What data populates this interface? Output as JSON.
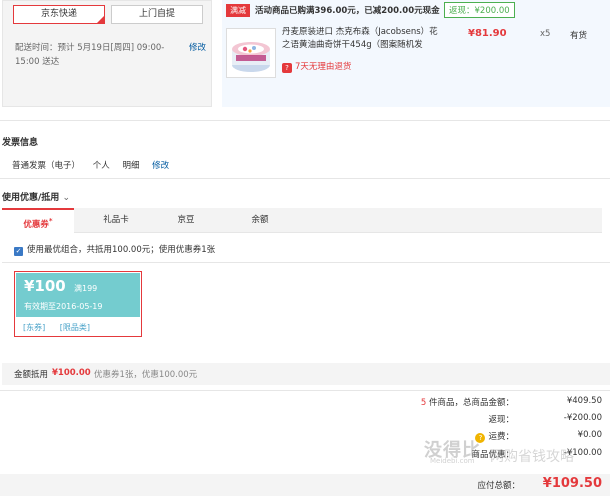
{
  "shipping": {
    "options": [
      "京东快递",
      "上门自提"
    ],
    "time_label": "配送时间：",
    "time_value": "预计 5月19日[周四] 09:00-15:00 送达",
    "edit": "修改"
  },
  "goods": {
    "promo_tag": "满减",
    "promo_text": "活动商品已购满396.00元，已减200.00元现金",
    "rebate": "返现：¥200.00",
    "name": "丹麦原装进口 杰克布森（Jacobsens）花之语黄油曲奇饼干454g（图案随机发",
    "price": "¥81.90",
    "qty": "x5",
    "stock": "有货",
    "return_policy": "7天无理由退货"
  },
  "invoice": {
    "title": "发票信息",
    "type": "普通发票（电子）",
    "holder": "个人",
    "content": "明细",
    "edit": "修改"
  },
  "coupon": {
    "title": "使用优惠/抵用",
    "tabs": [
      "优惠券",
      "礼品卡",
      "京豆",
      "余额"
    ],
    "combo_text": "使用最优组合，共抵用100.00元；使用优惠券1张",
    "card": {
      "amount": "¥100",
      "condition": "满199",
      "expiry": "有效期至2016-05-19",
      "links": [
        "[东券]",
        "[限品类]"
      ]
    },
    "total_label": "金额抵用",
    "total_value": "¥100.00",
    "total_detail": "优惠券1张，优惠100.00元"
  },
  "summary": {
    "rows": [
      {
        "count": "5",
        "label": " 件商品，总商品金额：",
        "value": "¥409.50"
      },
      {
        "label": "返现：",
        "value": "-¥200.00"
      },
      {
        "label": "运费：",
        "value": "¥0.00"
      },
      {
        "label": "商品优惠：",
        "value": "-¥100.00"
      }
    ],
    "pay_label": "应付总额：",
    "pay_value": "¥109.50"
  },
  "watermark": {
    "main": "没得比",
    "sub": "Meidebi.com",
    "side": "网购省钱攻略"
  },
  "colors": {
    "accent": "#e4393c",
    "link": "#005aa0",
    "coupon_bg": "#74cccf",
    "rebate_green": "#4caf50"
  }
}
